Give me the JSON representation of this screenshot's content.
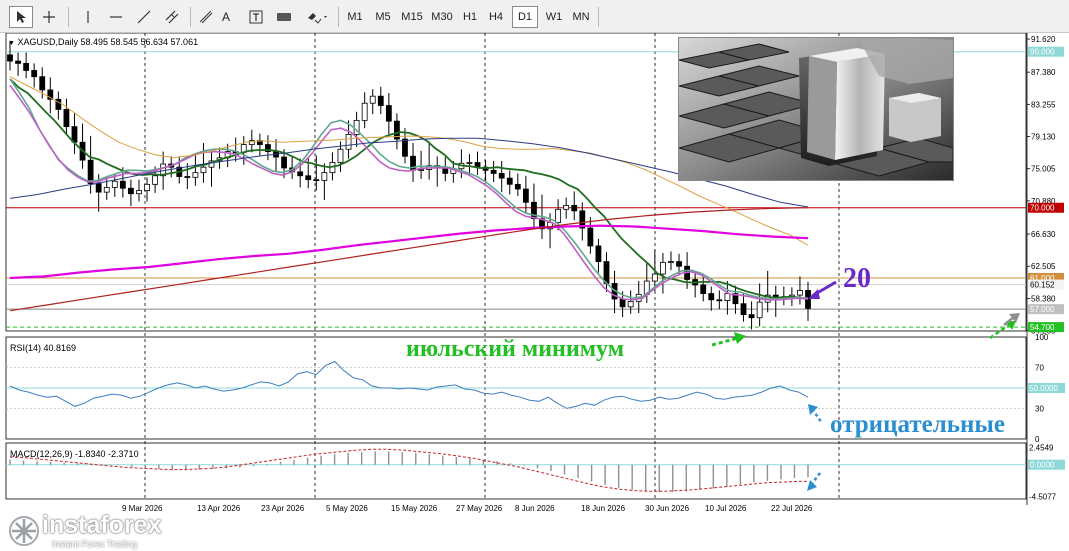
{
  "toolbar": {
    "timeframes": [
      "M1",
      "M5",
      "M15",
      "M30",
      "H1",
      "H4",
      "D1",
      "W1",
      "MN"
    ],
    "active_timeframe": "D1",
    "text_tool_label": "A",
    "tools": [
      "cursor-icon",
      "crosshair-icon",
      "vertical-line-icon",
      "horizontal-line-icon",
      "trendline-icon",
      "channel-icon",
      "text-icon",
      "text-label-icon",
      "rectangle-icon",
      "shapes-menu-icon"
    ]
  },
  "chart_header": {
    "symbol_line": "XAGUSD,Daily  58.495 58.545 56.634 57.061",
    "rsi_label": "RSI(14) 40.8169",
    "macd_label": "MACD(12,26,9) -1.8340 -2.3710"
  },
  "annotations": {
    "twenty": "20",
    "july_low": "июльский минимум",
    "negative": "отрицательные"
  },
  "logo": {
    "brand": "instaforex",
    "tagline": "Instant Forex Trading"
  },
  "colors": {
    "bg": "#ffffff",
    "candle": "#000000",
    "ma_fast_dark": "#1f6e1f",
    "ma_fast_light": "#5fa88c",
    "ma_pink": "#c060c8",
    "ma_orange": "#e0a040",
    "ma_navy": "#2b3b86",
    "ma_magenta": "#e000e0",
    "ma_red": "#b02020",
    "level_red": "#c00000",
    "level_gray": "#808080",
    "rsi_line": "#3d7fbf",
    "level_cyan": "#8fd8d8",
    "macd_signal": "#cc2222",
    "annotation_purple": "#6a2ac8",
    "annotation_green": "#22c022",
    "annotation_blue": "#2a8fd0"
  },
  "chart_data": [
    {
      "type": "candlestick",
      "title": "XAGUSD,Daily",
      "ohlc_header": [
        58.495,
        58.545,
        56.634,
        57.061
      ],
      "ylim": [
        54.2,
        92.4
      ],
      "yticks": [
        "91.620",
        "87.380",
        "83.255",
        "79.130",
        "75.005",
        "70.880",
        "66.630",
        "62.505",
        "58.380",
        "54.255"
      ],
      "xticks": [
        "9 Mar 2026",
        "13 Apr 2026",
        "23 Apr 2026",
        "5 May 2026",
        "15 May 2026",
        "27 May 2026",
        "8 Jun 2026",
        "18 Jun 2026",
        "30 Jun 2026",
        "10 Jul 2026",
        "22 Jul 2026"
      ],
      "levels": [
        {
          "label": "90.000",
          "value": 90.0
        },
        {
          "label": "70.000",
          "value": 70.0
        },
        {
          "label": "61.000",
          "value": 61.0
        },
        {
          "label": "60.152",
          "value": 60.152
        },
        {
          "label": "57.000",
          "value": 57.0
        },
        {
          "label": "54.700",
          "value": 54.7
        }
      ],
      "closes": [
        88.8,
        88.5,
        87.6,
        86.8,
        85.1,
        83.9,
        82.6,
        80.4,
        78.4,
        76.1,
        73.1,
        72.0,
        72.6,
        73.4,
        72.5,
        71.8,
        72.2,
        73.0,
        74.1,
        75.6,
        75.2,
        74.0,
        73.9,
        74.5,
        75.2,
        76.0,
        76.4,
        77.2,
        77.1,
        78.1,
        78.6,
        78.1,
        77.2,
        76.5,
        75.1,
        74.6,
        74.1,
        73.6,
        73.5,
        74.5,
        75.8,
        77.5,
        79.4,
        81.2,
        83.4,
        84.3,
        83.1,
        81.1,
        78.8,
        76.6,
        74.8,
        74.9,
        75.4,
        75.2,
        74.4,
        75.0,
        75.7,
        75.8,
        75.2,
        74.8,
        74.4,
        73.8,
        73.0,
        72.4,
        70.7,
        68.6,
        67.3,
        68.1,
        69.8,
        70.3,
        69.6,
        67.4,
        65.1,
        63.1,
        60.3,
        58.3,
        57.3,
        58.0,
        58.9,
        60.6,
        61.5,
        63.0,
        63.1,
        62.5,
        60.8,
        60.1,
        59.0,
        58.2,
        58.1,
        59.0,
        57.7,
        56.3,
        55.9,
        57.9,
        58.8,
        58.5,
        58.6,
        58.8,
        59.4,
        57.1
      ],
      "series": [
        {
          "name": "",
          "values": [
            86.5,
            85.4,
            84.7,
            83.5,
            82.3,
            81.2,
            79.9,
            78.6,
            77.5,
            76.5,
            76.2,
            75.6,
            75.1,
            74.6,
            74.3,
            74.2,
            74.3,
            74.2,
            74.4,
            74.6,
            74.9,
            75.3,
            75.5,
            75.9,
            76.3,
            76.6,
            77.0,
            77.3,
            77.4,
            77.4,
            77.3,
            77.0,
            76.5,
            75.9,
            75.7,
            75.4,
            75.2,
            75.4,
            75.9,
            76.6,
            77.5,
            78.4,
            79.0,
            79.4,
            79.7,
            79.6,
            79.2,
            78.6,
            77.6,
            76.8,
            75.7,
            75.4,
            75.3,
            75.1,
            75.1,
            75.2,
            75.0,
            74.9,
            74.8,
            74.5,
            74.3,
            74.0,
            73.6,
            72.9,
            72.4,
            71.3,
            70.0,
            68.9,
            67.4,
            66.0,
            64.9,
            63.8,
            62.8,
            61.6,
            61.0,
            60.8,
            60.5,
            60.4,
            60.5,
            60.5,
            60.5,
            60.2,
            59.7,
            59.3,
            59.0,
            58.7,
            58.5,
            58.5,
            58.6,
            58.5,
            58.3
          ]
        },
        {
          "name": "",
          "values": [
            86.5,
            84.7,
            82.7,
            80.1,
            78.1,
            76.1,
            75.0,
            74.1,
            73.4,
            73.5,
            74.0,
            74.4,
            74.8,
            74.8,
            74.7,
            74.9,
            75.2,
            75.6,
            76.4,
            76.9,
            77.3,
            77.5,
            77.5,
            77.3,
            76.8,
            76.1,
            75.3,
            74.7,
            74.5,
            74.9,
            76.0,
            77.6,
            79.4,
            80.9,
            81.2,
            80.6,
            79.5,
            78.3,
            76.9,
            75.9,
            75.3,
            75.1,
            75.3,
            75.3,
            75.3,
            75.2,
            74.9,
            74.5,
            74.0,
            73.2,
            72.2,
            71.1,
            70.0,
            69.3,
            69.0,
            68.8,
            68.3,
            67.1,
            65.6,
            63.9,
            62.2,
            60.7,
            59.5,
            58.8,
            58.4,
            58.6,
            59.6,
            60.6,
            61.3,
            61.9,
            62.0,
            61.6,
            60.9,
            60.0,
            59.3,
            59.2,
            58.8,
            58.5,
            58.3,
            58.3,
            58.4,
            58.5,
            58.4
          ]
        },
        {
          "name": "",
          "values": [
            85.7,
            84.0,
            82.2,
            80.1,
            78.0,
            76.2,
            74.8,
            73.9,
            73.3,
            73.3,
            73.8,
            74.1,
            74.4,
            74.4,
            74.5,
            74.8,
            75.2,
            75.6,
            76.2,
            76.8,
            77.1,
            77.2,
            77.1,
            76.9,
            76.3,
            75.6,
            75.0,
            74.4,
            74.2,
            74.6,
            75.6,
            76.9,
            78.5,
            80.0,
            80.2,
            79.7,
            78.6,
            77.2,
            75.9,
            75.1,
            74.8,
            74.7,
            75.0,
            75.1,
            75.1,
            75.1,
            74.7,
            74.3,
            73.6,
            72.8,
            71.8,
            70.6,
            69.5,
            68.9,
            68.7,
            68.4,
            67.9,
            66.5,
            64.8,
            63.0,
            61.3,
            59.8,
            58.8,
            58.3,
            58.2,
            58.4,
            59.4,
            60.3,
            61.0,
            61.6,
            61.8,
            61.4,
            60.6,
            59.7,
            58.9,
            58.8,
            58.6,
            58.3,
            58.2,
            58.2,
            58.3,
            58.4,
            58.3
          ]
        },
        {
          "name": "",
          "values": [
            86.8,
            85.6,
            84.4,
            83.1,
            81.4,
            79.8,
            78.4,
            77.5,
            76.8,
            76.4,
            76.7,
            77.2,
            77.8,
            78.4,
            78.6,
            78.4,
            78.5,
            78.6,
            78.7,
            78.9,
            79.0,
            79.1,
            79.2,
            79.1,
            78.9,
            78.5,
            77.9,
            77.6,
            77.5,
            77.5,
            77.6,
            77.3,
            77.0,
            76.4,
            75.8,
            74.9,
            73.8,
            72.7,
            71.5,
            70.5,
            69.5,
            68.4,
            67.4,
            66.5,
            65.2
          ]
        },
        {
          "name": "",
          "values": [
            71.2,
            71.7,
            72.4,
            73.0,
            73.7,
            74.4,
            75.0,
            75.6,
            76.1,
            76.6,
            77.0,
            77.5,
            77.9,
            78.3,
            78.5,
            78.8,
            78.9,
            78.9,
            78.6,
            78.2,
            77.7,
            77.0,
            76.2,
            75.4,
            74.6,
            73.7,
            72.8,
            71.7,
            70.7,
            70.1
          ]
        },
        {
          "name": "",
          "values": [
            61.0,
            61.2,
            61.7,
            62.1,
            62.4,
            62.9,
            63.4,
            63.8,
            64.1,
            64.6,
            65.2,
            65.7,
            66.2,
            66.7,
            67.1,
            67.4,
            67.6,
            67.7,
            67.6,
            67.3,
            67.0,
            66.6,
            66.3,
            66.1
          ]
        },
        {
          "name": "",
          "values": [
            56.8,
            57.6,
            58.4,
            59.2,
            60.0,
            60.8,
            61.6,
            62.4,
            63.2,
            64.0,
            64.8,
            65.6,
            66.4,
            67.2,
            67.9,
            68.5,
            69.0,
            69.4,
            69.7,
            69.9,
            70.0
          ]
        }
      ]
    },
    {
      "type": "line",
      "title": "RSI(14) 40.8169",
      "ylim": [
        0,
        100
      ],
      "yticks": [
        "100",
        "70",
        "50.0000",
        "30",
        "0"
      ],
      "levels": [
        {
          "label": "50.0000",
          "value": 50
        }
      ],
      "values": [
        52,
        48,
        46,
        43,
        41,
        42,
        37,
        32,
        35,
        40,
        42,
        44,
        43,
        40,
        42,
        46,
        50,
        53,
        55,
        53,
        50,
        52,
        49,
        47,
        48,
        50,
        53,
        56,
        55,
        52,
        56,
        64,
        66,
        63,
        72,
        76,
        67,
        60,
        58,
        52,
        50,
        50,
        49,
        50,
        49,
        48,
        51,
        52,
        53,
        49,
        48,
        45,
        44,
        46,
        43,
        41,
        38,
        37,
        41,
        35,
        30,
        32,
        35,
        33,
        38,
        41,
        42,
        39,
        37,
        38,
        41,
        39,
        40,
        43,
        46,
        44,
        40,
        39,
        41,
        42,
        43,
        46,
        50,
        52,
        48,
        46,
        41
      ]
    },
    {
      "type": "bar",
      "title": "MACD(12,26,9) -1.8340 -2.3710",
      "ylim": [
        -4.9,
        3.1
      ],
      "yticks": [
        "2.4549",
        "0.0000",
        "-4.5077"
      ],
      "histogram": [
        0.7,
        0.6,
        0.5,
        0.4,
        0.3,
        0.2,
        0.1,
        0.0,
        -0.1,
        -0.3,
        -0.5,
        -0.6,
        -0.7,
        -0.8,
        -0.7,
        -0.6,
        -0.5,
        -0.4,
        -0.2,
        0.1,
        0.4,
        0.7,
        1.0,
        1.3,
        1.5,
        1.7,
        1.8,
        1.9,
        1.9,
        1.8,
        1.7,
        1.5,
        1.3,
        1.1,
        0.9,
        0.7,
        0.5,
        0.2,
        -0.1,
        -0.5,
        -0.9,
        -1.4,
        -1.9,
        -2.4,
        -2.9,
        -3.3,
        -3.6,
        -3.8,
        -3.9,
        -3.9,
        -3.8,
        -3.6,
        -3.4,
        -3.1,
        -2.8,
        -2.5,
        -2.3,
        -2.1,
        -1.9,
        -1.8
      ],
      "signal": [
        1.1,
        1.0,
        0.8,
        0.6,
        0.4,
        0.2,
        0.0,
        -0.2,
        -0.4,
        -0.5,
        -0.6,
        -0.7,
        -0.7,
        -0.6,
        -0.5,
        -0.3,
        0.0,
        0.3,
        0.6,
        0.9,
        1.2,
        1.5,
        1.7,
        1.9,
        2.1,
        2.2,
        2.2,
        2.1,
        1.9,
        1.7,
        1.5,
        1.2,
        0.9,
        0.5,
        0.1,
        -0.3,
        -0.8,
        -1.3,
        -1.8,
        -2.3,
        -2.8,
        -3.2,
        -3.5,
        -3.7,
        -3.8,
        -3.8,
        -3.7,
        -3.6,
        -3.4,
        -3.2,
        -3.0,
        -2.8,
        -2.6,
        -2.5,
        -2.4,
        -2.37
      ]
    }
  ]
}
